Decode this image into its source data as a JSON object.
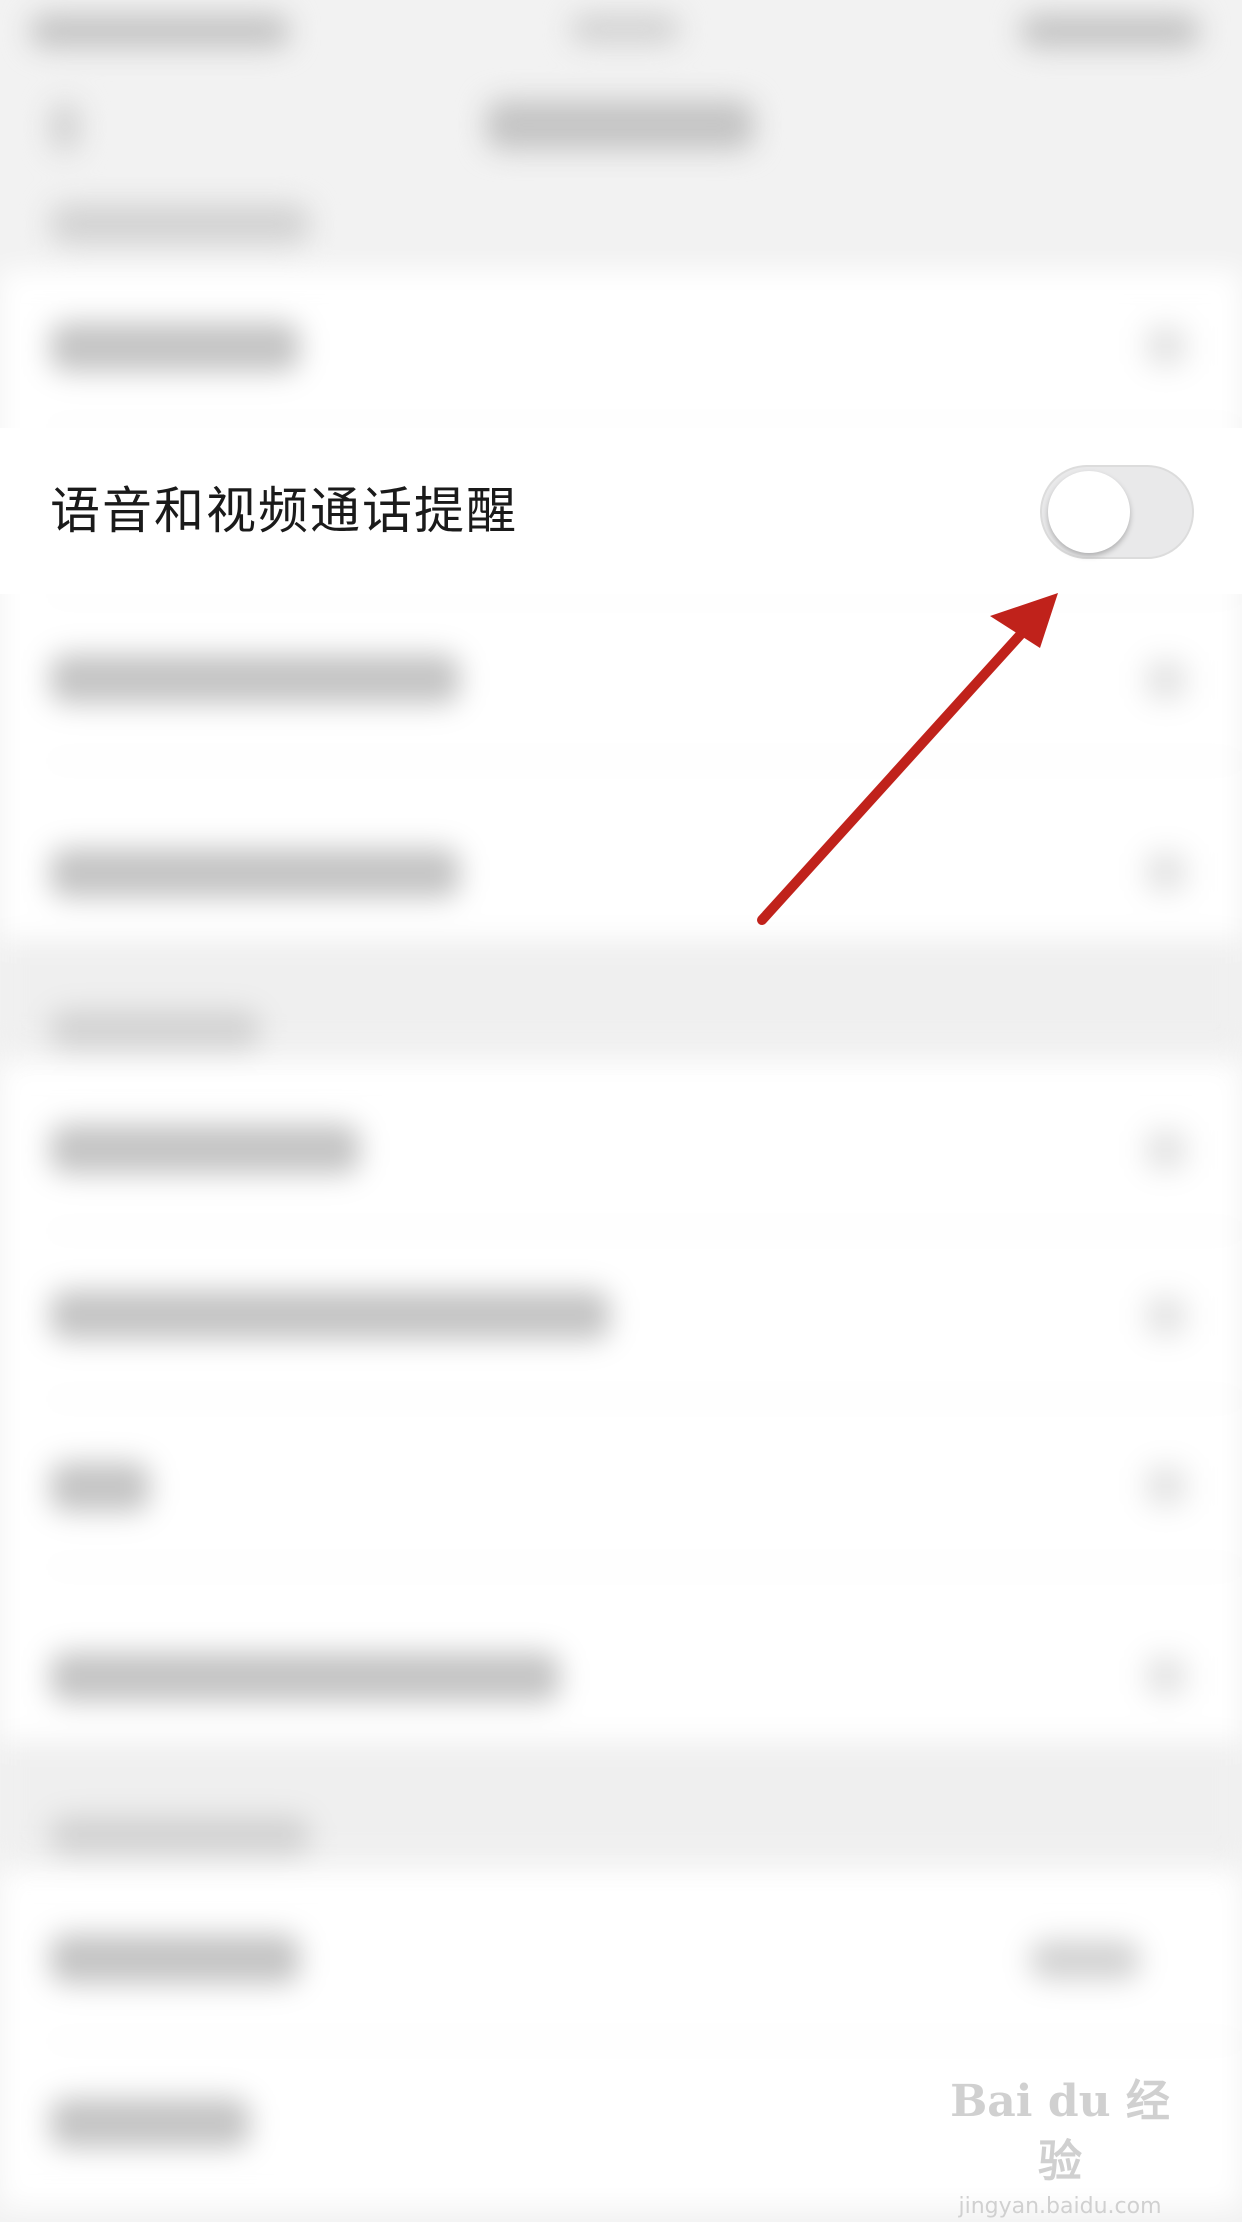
{
  "row": {
    "label": "语音和视频通话提醒"
  },
  "toggle": {
    "on": false,
    "label_hidden": ""
  },
  "colors": {
    "arrow": "#c0221b",
    "toggle_track": "#e9e9ea",
    "text": "#1a1a1a"
  },
  "watermark": {
    "logo": "Bai du 经验",
    "url": "jingyan.baidu.com"
  }
}
